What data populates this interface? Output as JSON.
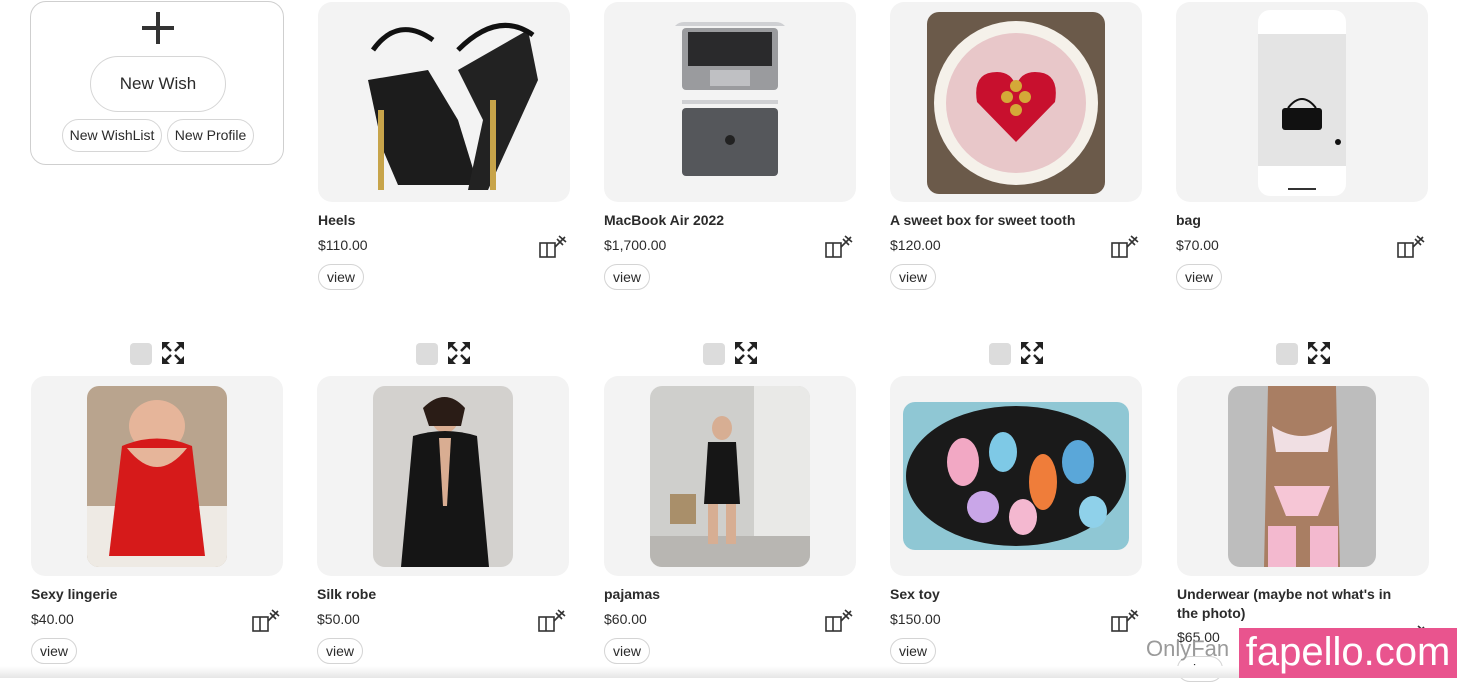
{
  "new_card": {
    "new_wish_label": "New Wish",
    "new_wishlist_label": "New WishList",
    "new_profile_label": "New Profile"
  },
  "view_label": "view",
  "row1": [
    {
      "title": "Heels",
      "price": "$110.00"
    },
    {
      "title": "MacBook Air 2022",
      "price": "$1,700.00"
    },
    {
      "title": "A sweet box for sweet tooth",
      "price": "$120.00"
    },
    {
      "title": "bag",
      "price": "$70.00"
    }
  ],
  "row2": [
    {
      "title": "Sexy lingerie",
      "price": "$40.00"
    },
    {
      "title": "Silk robe",
      "price": "$50.00"
    },
    {
      "title": "pajamas",
      "price": "$60.00"
    },
    {
      "title": "Sex toy",
      "price": "$150.00"
    },
    {
      "title": "Underwear (maybe not what's in the photo)",
      "price": "$65.00"
    }
  ],
  "watermark": {
    "text": "OnlyFan",
    "brand": "fapello.com"
  },
  "icons": [
    "plus-icon",
    "gift-icon",
    "checkbox-icon",
    "expand-icon"
  ],
  "colors": {
    "card_bg": "#f3f3f3",
    "brand_pink": "#e9548e",
    "text": "#2b2b2b"
  }
}
